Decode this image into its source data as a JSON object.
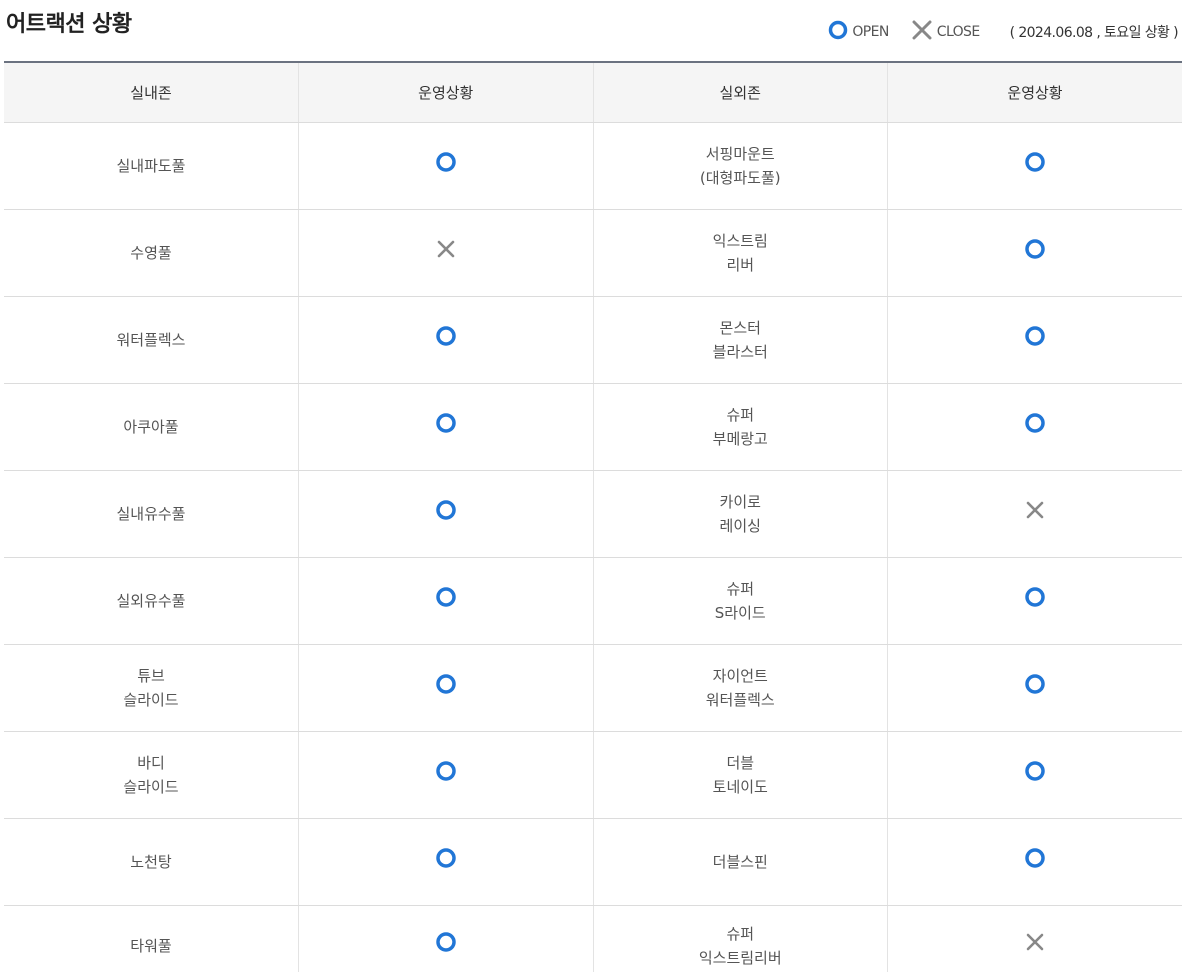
{
  "title": "어트랙션 상황",
  "legend": {
    "open_label": "OPEN",
    "close_label": "CLOSE",
    "date_text": "( 2024.06.08 , 토요일 상황 )"
  },
  "colors": {
    "open": "#2176d6",
    "close": "#888888"
  },
  "table": {
    "headers": [
      "실내존",
      "운영상황",
      "실외존",
      "운영상황"
    ],
    "rows": [
      {
        "indoor": "실내파도풀",
        "indoor_status": "open",
        "outdoor": "서핑마운트\n(대형파도풀)",
        "outdoor_status": "open"
      },
      {
        "indoor": "수영풀",
        "indoor_status": "close",
        "outdoor": "익스트림\n리버",
        "outdoor_status": "open"
      },
      {
        "indoor": "워터플렉스",
        "indoor_status": "open",
        "outdoor": "몬스터\n블라스터",
        "outdoor_status": "open"
      },
      {
        "indoor": "아쿠아풀",
        "indoor_status": "open",
        "outdoor": "슈퍼\n부메랑고",
        "outdoor_status": "open"
      },
      {
        "indoor": "실내유수풀",
        "indoor_status": "open",
        "outdoor": "카이로\n레이싱",
        "outdoor_status": "close"
      },
      {
        "indoor": "실외유수풀",
        "indoor_status": "open",
        "outdoor": "슈퍼\nS라이드",
        "outdoor_status": "open"
      },
      {
        "indoor": "튜브\n슬라이드",
        "indoor_status": "open",
        "outdoor": "자이언트\n워터플렉스",
        "outdoor_status": "open"
      },
      {
        "indoor": "바디\n슬라이드",
        "indoor_status": "open",
        "outdoor": "더블\n토네이도",
        "outdoor_status": "open"
      },
      {
        "indoor": "노천탕",
        "indoor_status": "open",
        "outdoor": "더블스핀",
        "outdoor_status": "open"
      },
      {
        "indoor": "타워풀",
        "indoor_status": "open",
        "outdoor": "슈퍼\n익스트림리버",
        "outdoor_status": "close"
      }
    ]
  }
}
